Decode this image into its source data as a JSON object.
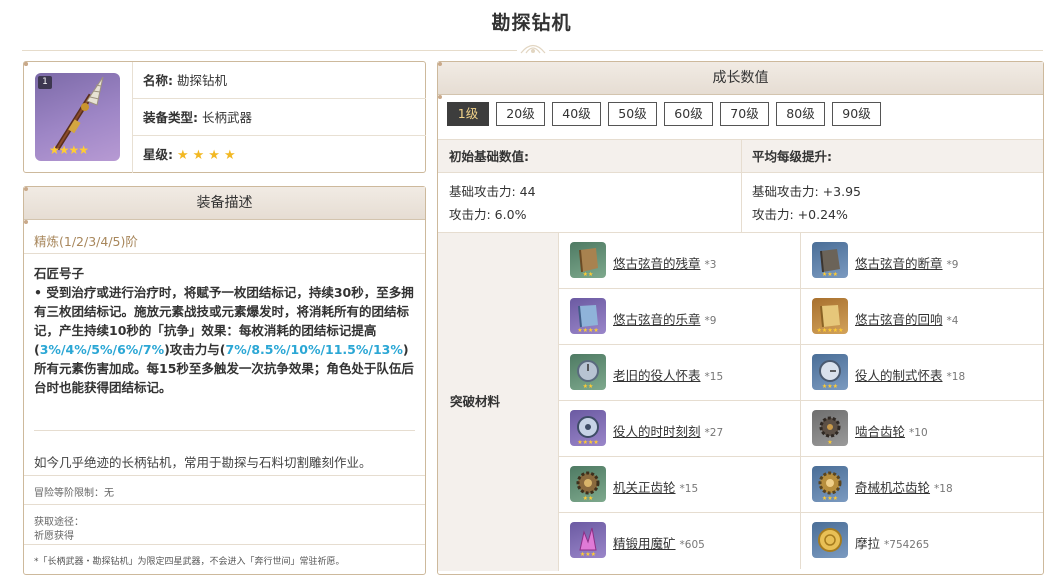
{
  "page": {
    "title": "勘探钻机"
  },
  "info": {
    "level_badge": "1",
    "name_label": "名称:",
    "name_value": "勘探钻机",
    "type_label": "装备类型:",
    "type_value": "长柄武器",
    "rarity_label": "星级:",
    "rarity_stars": "★★★★",
    "rarity_value": 4
  },
  "description": {
    "header": "装备描述",
    "refine": "精炼(1/2/3/4/5)阶",
    "skill_name": "石匠号子",
    "skill_text_1": "• 受到治疗或进行治疗时，将赋予一枚团结标记，持续30秒，至多拥有三枚团结标记。施放元素战技或元素爆发时，将消耗所有的团结标记，产生持续10秒的「抗争」效果：每枚消耗的团结标记提高(",
    "skill_hl_1": "3%/4%/5%/6%/7%",
    "skill_text_2": ")攻击力与(",
    "skill_hl_2": "7%/8.5%/10%/11.5%/13%",
    "skill_text_3": ")所有元素伤害加成。每15秒至多触发一次抗争效果；角色处于队伍后台时也能获得团结标记。",
    "flavor": "如今几乎绝迹的长柄钻机，常用于勘探与石料切割雕刻作业。",
    "limit": "冒险等阶限制：无",
    "source_label": "获取途径：",
    "source_value": "祈愿获得",
    "note": "*「长柄武器・勘探钻机」为限定四星武器，不会进入「奔行世间」常驻祈愿。"
  },
  "growth": {
    "header": "成长数值",
    "levels": [
      "1级",
      "20级",
      "40级",
      "50级",
      "60级",
      "70级",
      "80级",
      "90级"
    ],
    "active_level": "1级",
    "base_header": "初始基础数值:",
    "growth_header": "平均每级提升:",
    "base_atk": "基础攻击力: 44",
    "base_sub": "攻击力: 6.0%",
    "growth_atk": "基础攻击力: +3.95",
    "growth_sub": "攻击力: +0.24%",
    "materials_label": "突破材料",
    "materials": [
      {
        "name": "悠古弦音的残章",
        "count": "*3",
        "icon": "scroll-fragment-icon",
        "stars": "★★"
      },
      {
        "name": "悠古弦音的断章",
        "count": "*9",
        "icon": "scroll-broken-icon",
        "stars": "★★★"
      },
      {
        "name": "悠古弦音的乐章",
        "count": "*9",
        "icon": "scroll-movement-icon",
        "stars": "★★★★"
      },
      {
        "name": "悠古弦音的回响",
        "count": "*4",
        "icon": "scroll-echo-icon",
        "stars": "★★★★★"
      },
      {
        "name": "老旧的役人怀表",
        "count": "*15",
        "icon": "old-pocket-watch-icon",
        "stars": "★★"
      },
      {
        "name": "役人的制式怀表",
        "count": "*18",
        "icon": "standard-pocket-watch-icon",
        "stars": "★★★"
      },
      {
        "name": "役人的时时刻刻",
        "count": "*27",
        "icon": "timepiece-icon",
        "stars": "★★★★"
      },
      {
        "name": "啮合齿轮",
        "count": "*10",
        "icon": "meshing-gear-icon",
        "stars": "★"
      },
      {
        "name": "机关正齿轮",
        "count": "*15",
        "icon": "spur-gear-icon",
        "stars": "★★"
      },
      {
        "name": "奇械机芯齿轮",
        "count": "*18",
        "icon": "mechanism-gear-icon",
        "stars": "★★★"
      },
      {
        "name": "精锻用魔矿",
        "count": "*605",
        "icon": "mystic-ore-icon",
        "stars": "★★★"
      },
      {
        "name": "摩拉",
        "count": "*754265",
        "icon": "mora-icon",
        "stars": ""
      }
    ]
  }
}
